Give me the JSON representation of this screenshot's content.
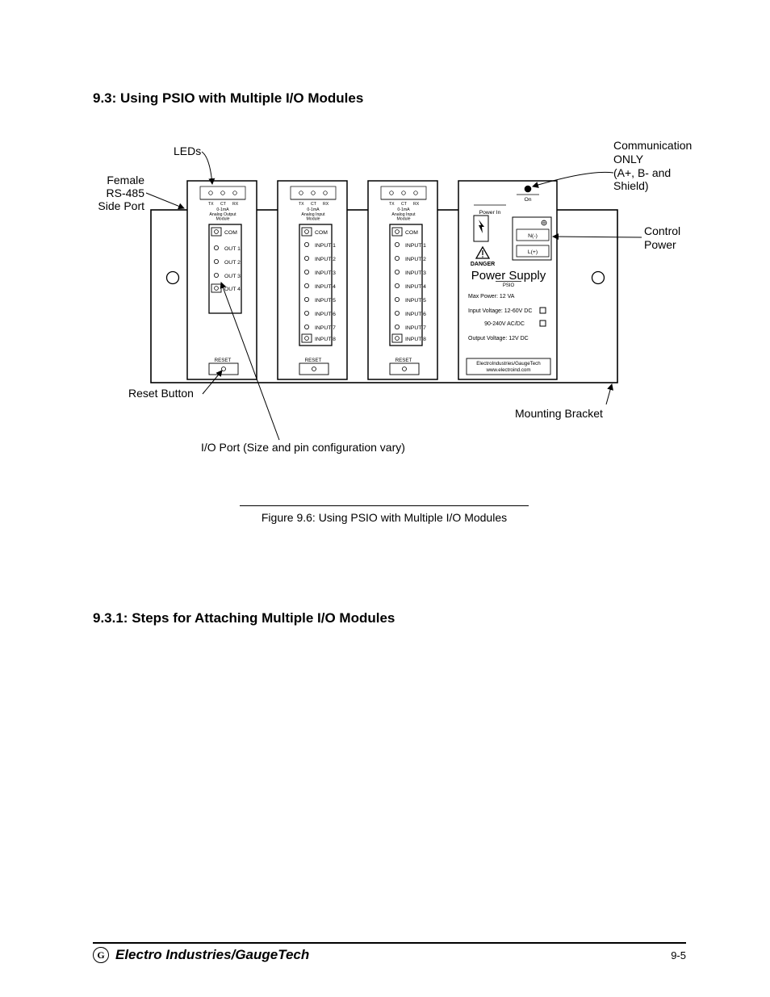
{
  "headings": {
    "section_9_3": "9.3: Using PSIO with Multiple I/O Modules",
    "section_9_3_1": "9.3.1: Steps for Attaching Multiple I/O Modules"
  },
  "figure_caption": "Figure 9.6: Using PSIO with Multiple I/O Modules",
  "annotations": {
    "leds": "LEDs",
    "female_rs485": "Female\nRS-485\nSide Port",
    "reset_button": "Reset Button",
    "io_port": "I/O Port (Size and pin configuration vary)",
    "comm_only": "Communication\nONLY\n(A+, B- and\nShield)",
    "control_power": "Control\nPower",
    "mounting_bracket": "Mounting Bracket"
  },
  "modules": {
    "tx": "TX",
    "ct": "CT",
    "rx": "RX",
    "range": "0-1mA",
    "type_output": "Analog Output\nModule",
    "type_input": "Analog Input\nModule",
    "com": "COM",
    "out": "OUT",
    "input": "INPUT",
    "reset": "RESET"
  },
  "psio": {
    "on": "On",
    "power_in": "Power In",
    "n_minus": "N(-)",
    "l_plus": "L(+)",
    "danger": "DANGER",
    "title": "Power Supply",
    "subtitle": "PSIO",
    "max_power": "Max Power:  12 VA",
    "input_voltage": "Input Voltage:  12-60V DC",
    "input_voltage2": "90-240V AC/DC",
    "output_voltage": "Output Voltage:  12V DC",
    "company": "ElectroIndustries/GaugeTech",
    "url": "www.electroind.com"
  },
  "footer": {
    "company": "Electro Industries/GaugeTech",
    "page": "9-5",
    "logo_letter": "G"
  }
}
